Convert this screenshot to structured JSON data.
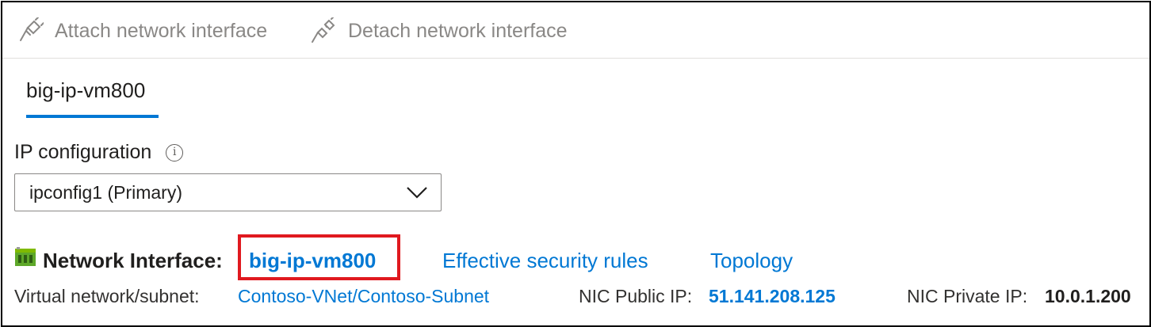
{
  "toolbar": {
    "attach_label": "Attach network interface",
    "detach_label": "Detach network interface"
  },
  "tab": {
    "label": "big-ip-vm800"
  },
  "ip_configuration": {
    "label": "IP configuration",
    "selected": "ipconfig1 (Primary)"
  },
  "network_interface": {
    "label": "Network Interface:",
    "name": "big-ip-vm800",
    "effective_security_rules": "Effective security rules",
    "topology": "Topology"
  },
  "details": {
    "vnet_label": "Virtual network/subnet:",
    "vnet_value": "Contoso-VNet/Contoso-Subnet",
    "public_ip_label": "NIC Public IP:",
    "public_ip_value": "51.141.208.125",
    "private_ip_label": "NIC Private IP:",
    "private_ip_value": "10.0.1.200"
  },
  "colors": {
    "link": "#0078d4",
    "highlight": "#e0191f",
    "disabled_text": "#8a8886"
  },
  "icons": [
    "plug-connect-icon",
    "plug-disconnect-icon",
    "info-icon",
    "chevron-down-icon",
    "network-interface-icon"
  ]
}
